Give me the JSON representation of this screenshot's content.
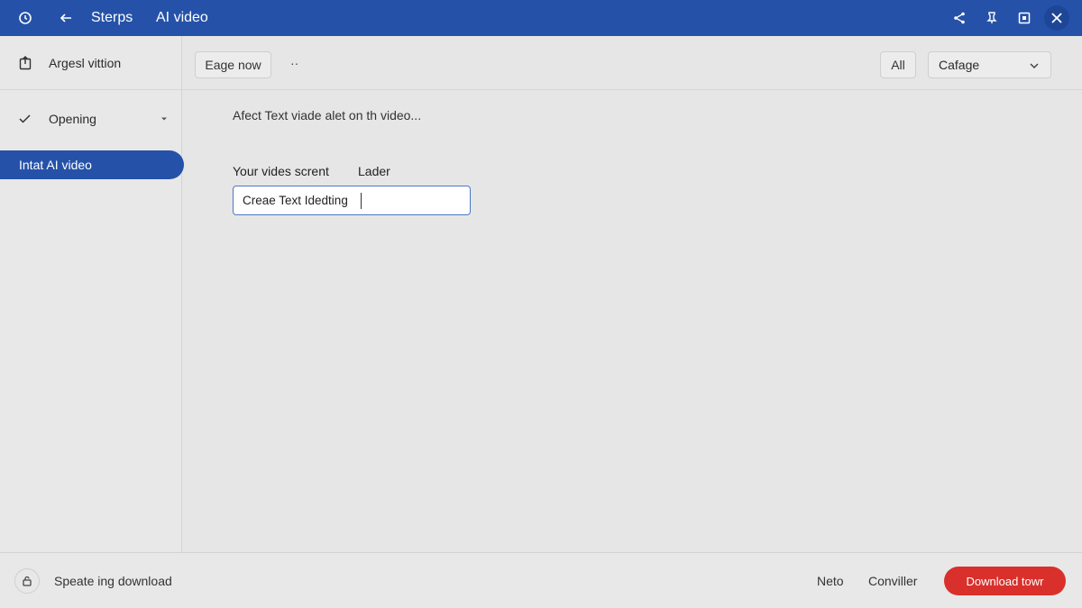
{
  "titlebar": {
    "back_label": "Sterps",
    "title": "AI video",
    "icons": [
      "history-icon",
      "back-arrow-icon",
      "share-icon",
      "pin-icon",
      "window-icon",
      "close-icon"
    ]
  },
  "sidebar": {
    "header_label": "Argesl vittion",
    "items": [
      {
        "label": "Opening",
        "icon": "check-icon"
      }
    ],
    "active_label": "Intat AI video"
  },
  "toolbar": {
    "eage_label": "Eage now",
    "more_label": "··",
    "all_label": "All",
    "select_value": "Cafage"
  },
  "content": {
    "hint": "Afect Text viade alet on th video...",
    "field_label": "Your vides scrent",
    "field_label_secondary": "Lader",
    "input_value": "Creae Text Idedting"
  },
  "footer": {
    "status": "Speate ing download",
    "link1": "Neto",
    "link2": "Conviller",
    "download_label": "Download towr"
  },
  "colors": {
    "accent": "#2552a8",
    "download": "#d9302b",
    "background": "#e6e6e6"
  }
}
